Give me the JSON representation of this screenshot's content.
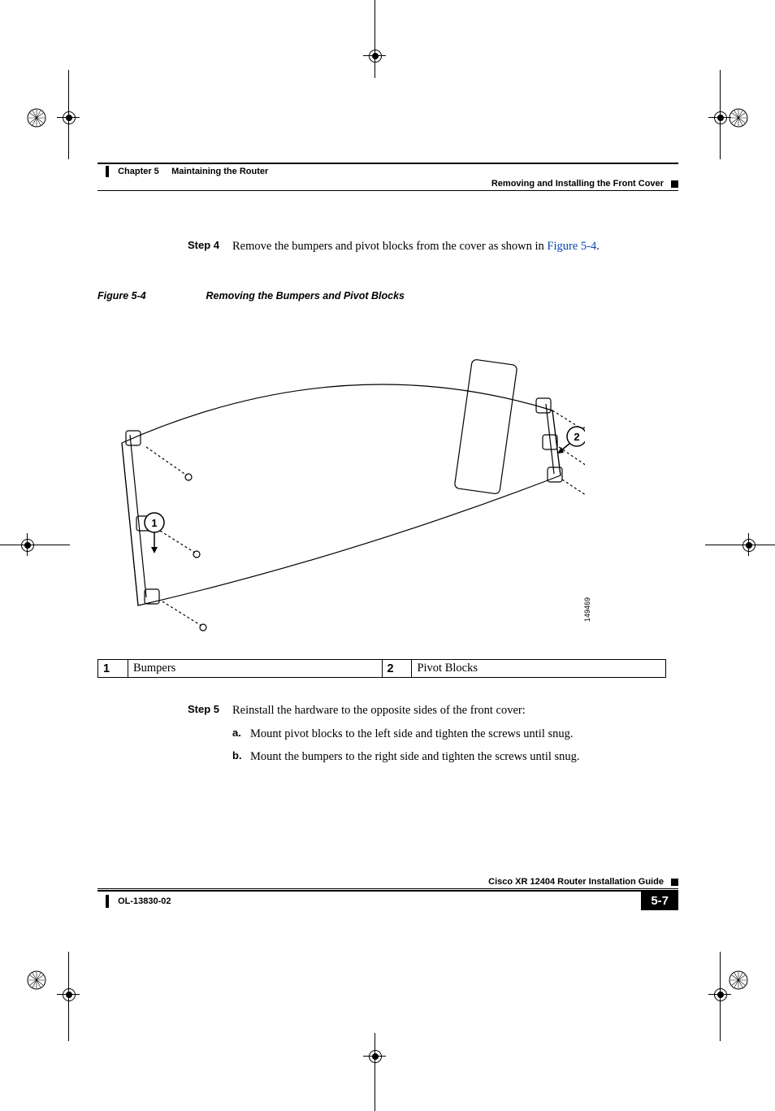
{
  "header": {
    "chapter_label": "Chapter 5",
    "chapter_title": "Maintaining the Router",
    "section_title": "Removing and Installing the Front Cover"
  },
  "step4": {
    "label": "Step 4",
    "text_before": "Remove the bumpers and pivot blocks from the cover as shown in ",
    "fig_ref": "Figure 5-4",
    "text_after": "."
  },
  "figure": {
    "number": "Figure 5-4",
    "title": "Removing the Bumpers and Pivot Blocks",
    "callout_1": "1",
    "callout_2": "2",
    "image_id": "149469"
  },
  "chart_data": {
    "type": "table",
    "rows": [
      {
        "num": "1",
        "label": "Bumpers"
      },
      {
        "num": "2",
        "label": "Pivot Blocks"
      }
    ]
  },
  "step5": {
    "label": "Step 5",
    "text": "Reinstall the hardware to the opposite sides of the front cover:",
    "a_letter": "a.",
    "a_text": "Mount pivot blocks to the left side and tighten the screws until snug.",
    "b_letter": "b.",
    "b_text": "Mount the bumpers to the right side and tighten the screws until snug."
  },
  "footer": {
    "book_title": "Cisco XR 12404 Router Installation Guide",
    "doc_number": "OL-13830-02",
    "page_number": "5-7"
  }
}
